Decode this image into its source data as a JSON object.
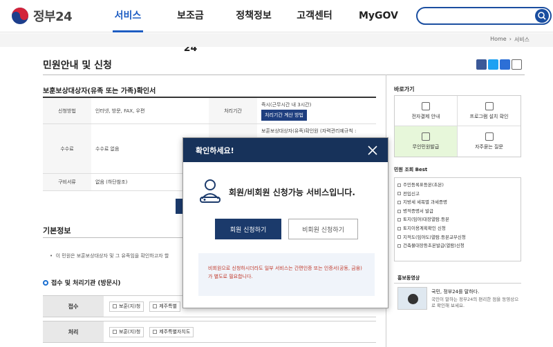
{
  "header": {
    "logo_text": "정부24",
    "nav": [
      "서비스",
      "보조금24",
      "정책정보",
      "고객센터",
      "MyGOV"
    ],
    "active_nav": "서비스"
  },
  "breadcrumb": [
    "Home",
    "서비스"
  ],
  "page_title": "민원안내 및 신청",
  "section_title": "보훈보상대상자(유족 또는 가족)확인서",
  "table": {
    "row1": {
      "h1": "신청방법",
      "v1": "인터넷, 방문, FAX, 우편",
      "h2": "처리기간",
      "v2": "즉시(근무시간 내 3시간)",
      "btn": "처리기간 계산 방법"
    },
    "row2": {
      "h1": "수수료",
      "v1": "수수료 없음",
      "v2": "보훈보상대상자(유족)확인원 (자력관리예규칙 :"
    },
    "row3": {
      "h1": "구비서류",
      "v1": "없음 (하단참조)"
    }
  },
  "basic_title": "기본정보",
  "bullet_text": "이 민원은 보훈보상대상자 및 그 유족임을 확인하고자 할",
  "receive_title": "접수 및 처리기관 (방문시)",
  "receive_row": {
    "label": "접수",
    "chip1": "보훈(지)청",
    "chip2": "제주특별"
  },
  "process_row": {
    "label": "처리",
    "chip1": "보훈(지)청",
    "chip2": "제주특별자치도"
  },
  "sidebar": {
    "quick_title": "바로가기",
    "quick": [
      "전자결제 안내",
      "프로그램 설치 확인",
      "무인민원발급",
      "자주묻는 질문"
    ],
    "best_title": "민원 조회 Best",
    "best": [
      "주민등록표등본(초본)",
      "전입신고",
      "지방세 세목별 과세증명",
      "병적증명서 발급",
      "토지(임야)대장열람.등본",
      "토지이용계획확인 신청",
      "지적도(임야도)열람.등본교부신청",
      "건축물대장등초본발급(열람)신청"
    ],
    "promo_title": "홍보동영상",
    "promo_headline": "국민, 정부24를 말하다.",
    "promo_desc": "국민이 말하는 정부24의 편리한 점을 동영상으로 확인해 보세요."
  },
  "modal": {
    "title": "확인하세요!",
    "message": "회원/비회원 신청가능 서비스입니다.",
    "member_btn": "회원 신청하기",
    "guest_btn": "비회원 신청하기",
    "notice": "비회원으로 신청하시더라도 일부 서비스는 간편인증 또는 인증서(공동, 금융)가 별도로 필요합니다."
  }
}
